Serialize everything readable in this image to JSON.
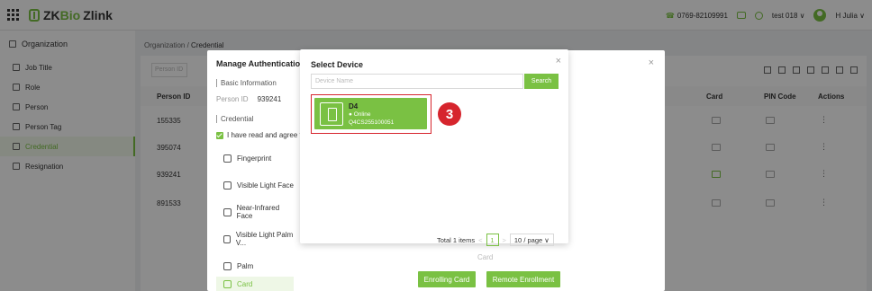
{
  "header": {
    "brand_zk": "ZK",
    "brand_bio": "Bio",
    "brand_zlink": "Zlink",
    "phone": "0769-82109991",
    "user": "test 018 ∨",
    "account": "H Julia ∨"
  },
  "sidebar": {
    "org": "Organization",
    "items": [
      {
        "label": "Job Title"
      },
      {
        "label": "Role"
      },
      {
        "label": "Person"
      },
      {
        "label": "Person Tag"
      },
      {
        "label": "Credential"
      },
      {
        "label": "Resignation"
      }
    ]
  },
  "breadcrumb": {
    "root": "Organization /",
    "current": "Credential"
  },
  "table": {
    "search_placeholder": "Person ID",
    "headers": {
      "person_id": "Person ID",
      "card": "Card",
      "pin": "PIN Code",
      "actions": "Actions"
    },
    "rows": [
      "155335",
      "395074",
      "939241",
      "891533"
    ],
    "row_action": "⋮"
  },
  "manage": {
    "title": "Manage Authenticatior",
    "basic_info": "Basic Information",
    "person_id_label": "Person ID",
    "person_id_value": "939241",
    "credential": "Credential",
    "agree": "I have read and agree to",
    "methods": [
      {
        "label": "Fingerprint"
      },
      {
        "label": "Visible Light Face"
      },
      {
        "label": "Near-Infrared Face"
      },
      {
        "label": "Visible Light Palm V..."
      },
      {
        "label": "Palm"
      },
      {
        "label": "Card"
      }
    ],
    "card_word": "Card",
    "enrolling_card": "Enrolling Card",
    "remote_enrollment": "Remote Enrollment",
    "close": "×"
  },
  "select_device": {
    "title": "Select Device",
    "close": "×",
    "search_placeholder": "Device Name",
    "search_label": "Search",
    "device": {
      "name": "D4",
      "status": "Online",
      "sn": "Q4CS255100051"
    },
    "step": "3",
    "pager": {
      "total": "Total 1 items",
      "prev": "<",
      "page": "1",
      "next": ">",
      "size": "10 / page ∨"
    }
  },
  "colors": {
    "accent": "#7ac143",
    "highlight": "#d6252d"
  }
}
